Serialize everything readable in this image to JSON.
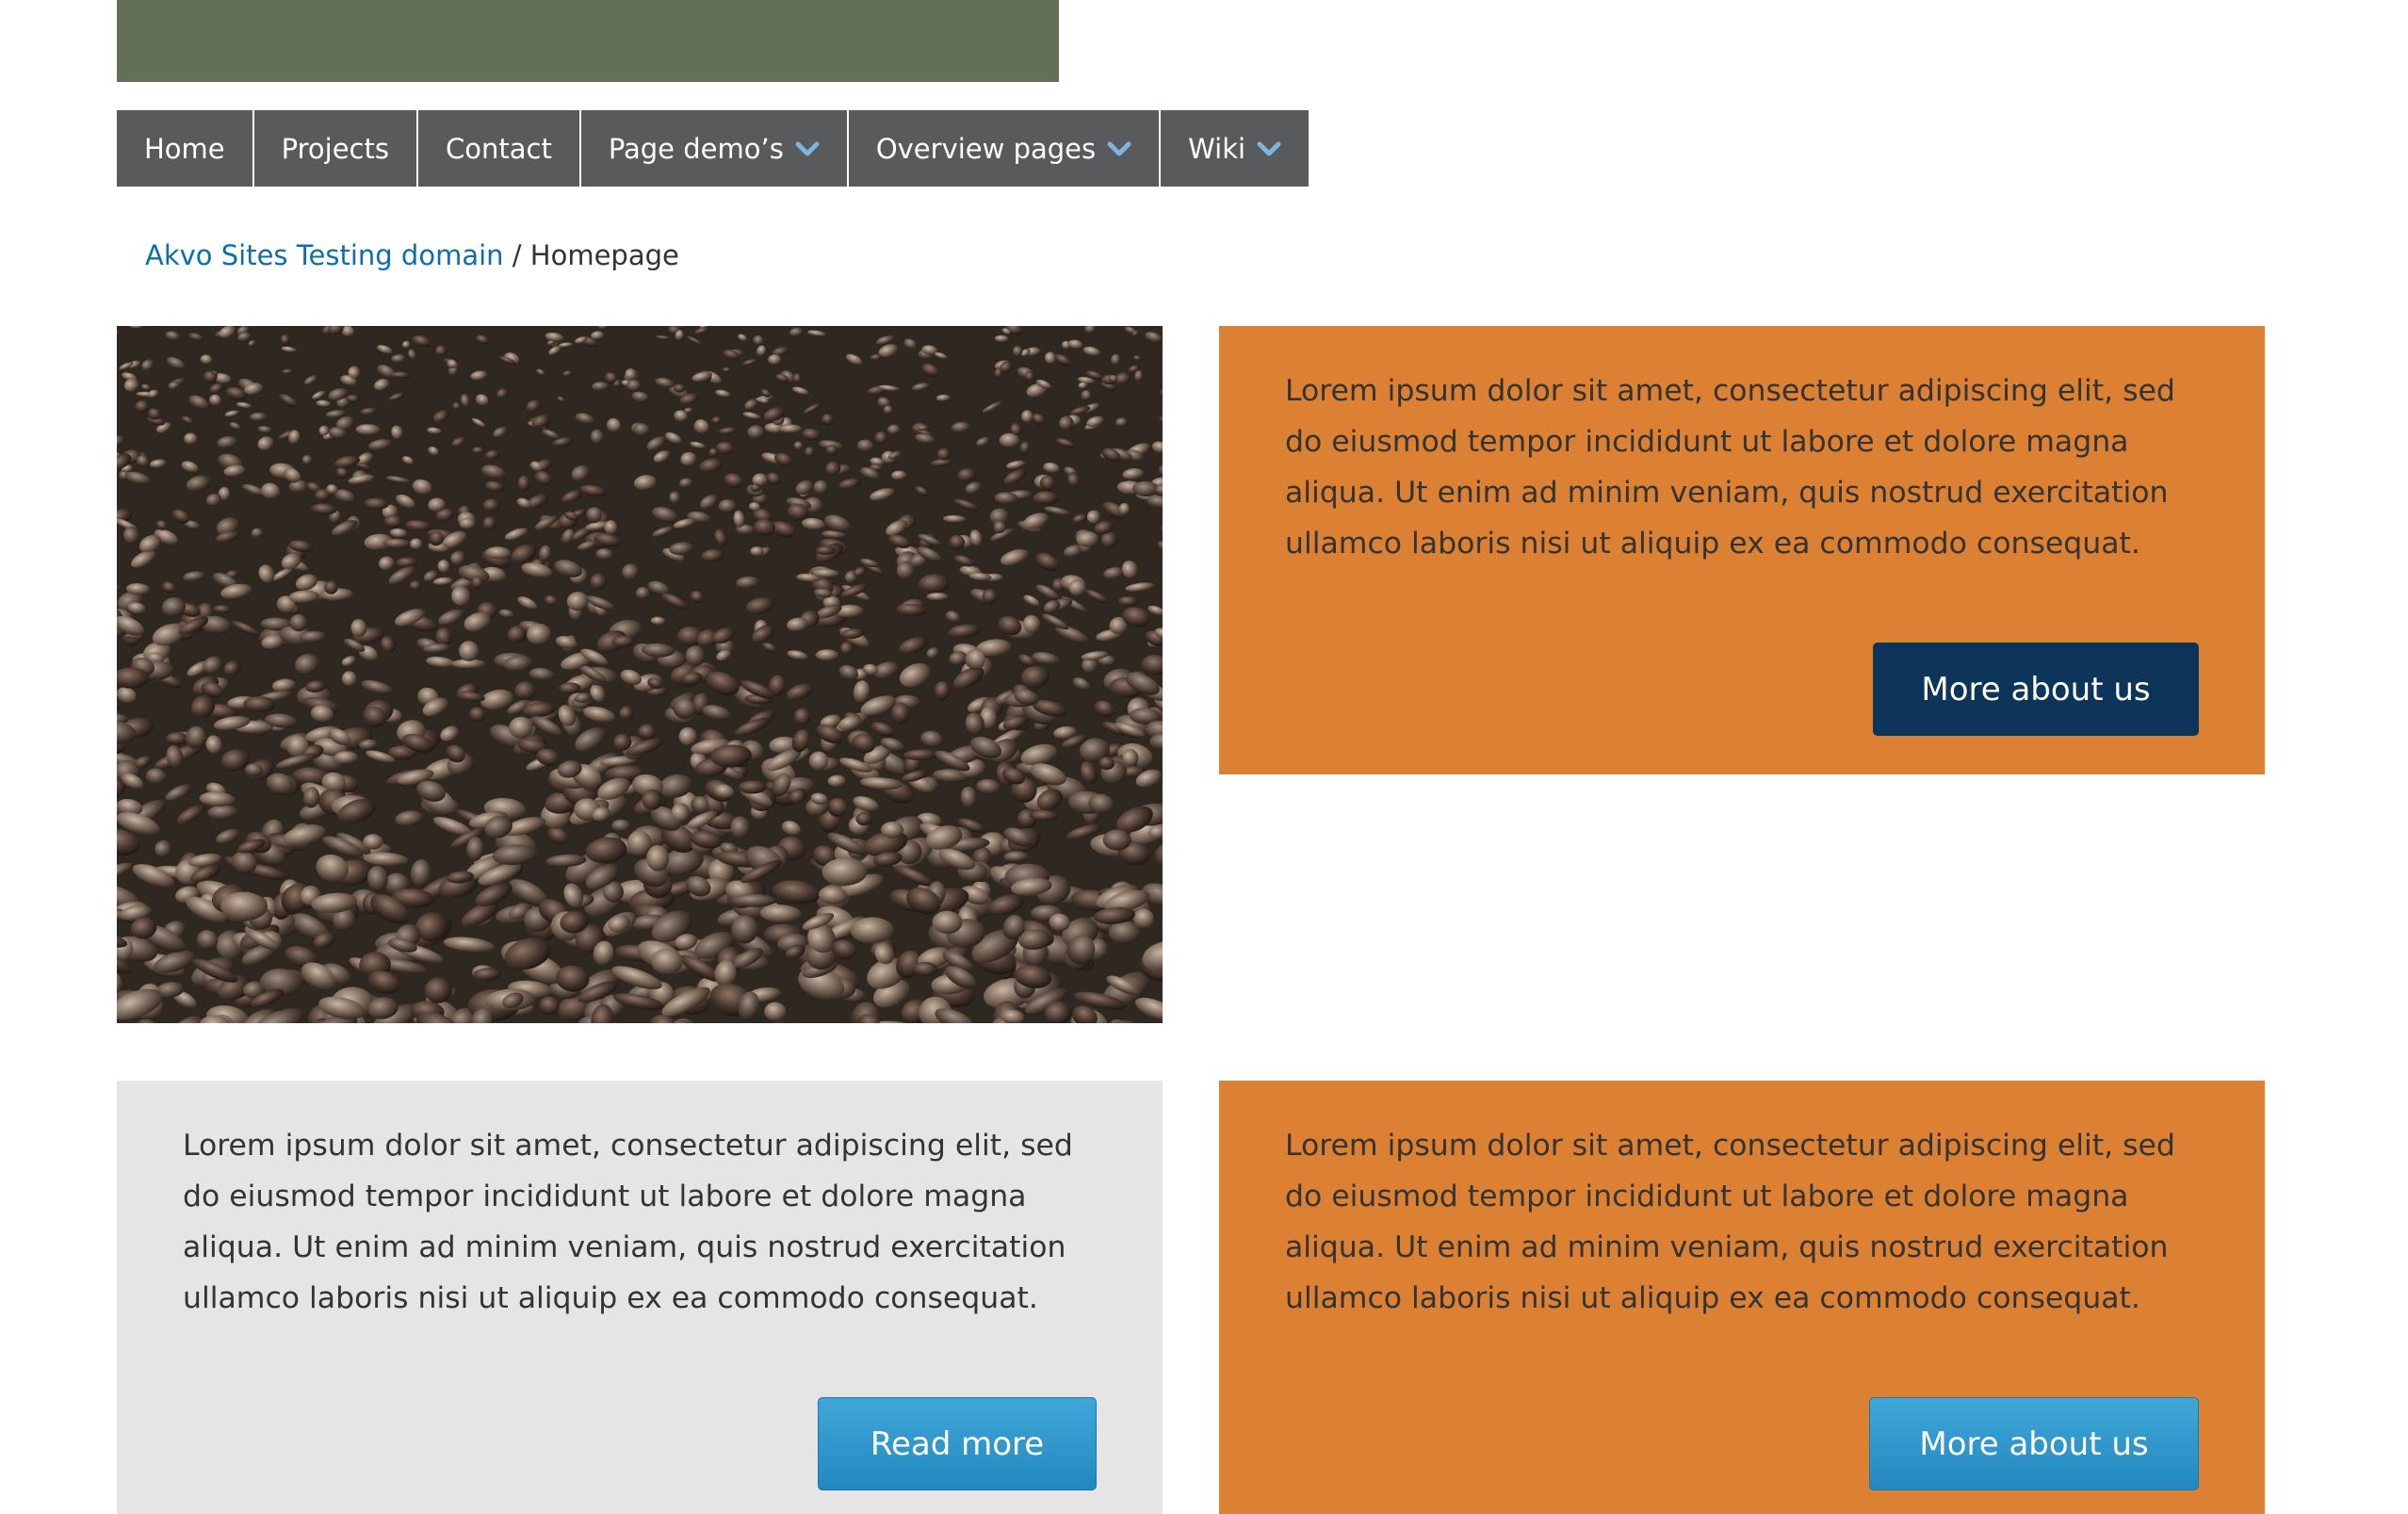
{
  "header": {
    "banner_color": "#636f56"
  },
  "nav": {
    "items": [
      {
        "label": "Home",
        "has_dropdown": false
      },
      {
        "label": "Projects",
        "has_dropdown": false
      },
      {
        "label": "Contact",
        "has_dropdown": false
      },
      {
        "label": "Page demo’s",
        "has_dropdown": true,
        "icon": "chevron-down-icon"
      },
      {
        "label": "Overview pages",
        "has_dropdown": true,
        "icon": "chevron-down-icon"
      },
      {
        "label": "Wiki",
        "has_dropdown": true,
        "icon": "chevron-down-icon"
      }
    ]
  },
  "breadcrumb": {
    "link": "Akvo Sites Testing domain",
    "separator": "/",
    "current": "Homepage"
  },
  "hero": {
    "image": "pebbles-closeup-photo"
  },
  "cards": [
    {
      "text": "Lorem ipsum dolor sit amet, consectetur adipiscing elit, sed do eiusmod tempor incididunt ut labore et dolore magna aliqua. Ut enim ad minim veniam, quis nostrud exercitation ullamco laboris nisi ut aliquip ex ea commodo consequat.",
      "button": "More about us"
    },
    {
      "text": "Lorem ipsum dolor sit amet, consectetur adipiscing elit, sed do eiusmod tempor incididunt ut labore et dolore magna aliqua. Ut enim ad minim veniam, quis nostrud exercitation ullamco laboris nisi ut aliquip ex ea commodo consequat.",
      "button": "Read more"
    },
    {
      "text": "Lorem ipsum dolor sit amet, consectetur adipiscing elit, sed do eiusmod tempor incididunt ut labore et dolore magna aliqua. Ut enim ad minim veniam, quis nostrud exercitation ullamco laboris nisi ut aliquip ex ea commodo consequat.",
      "button": "More about us"
    }
  ],
  "colors": {
    "nav_bg": "#585a5b",
    "link": "#0d6eaf",
    "chevron": "#7fb4df",
    "orange": "#dc8033",
    "grey": "#e5e5e5",
    "dark_button": "#0c3559",
    "blue_button": "#2e98cf"
  }
}
